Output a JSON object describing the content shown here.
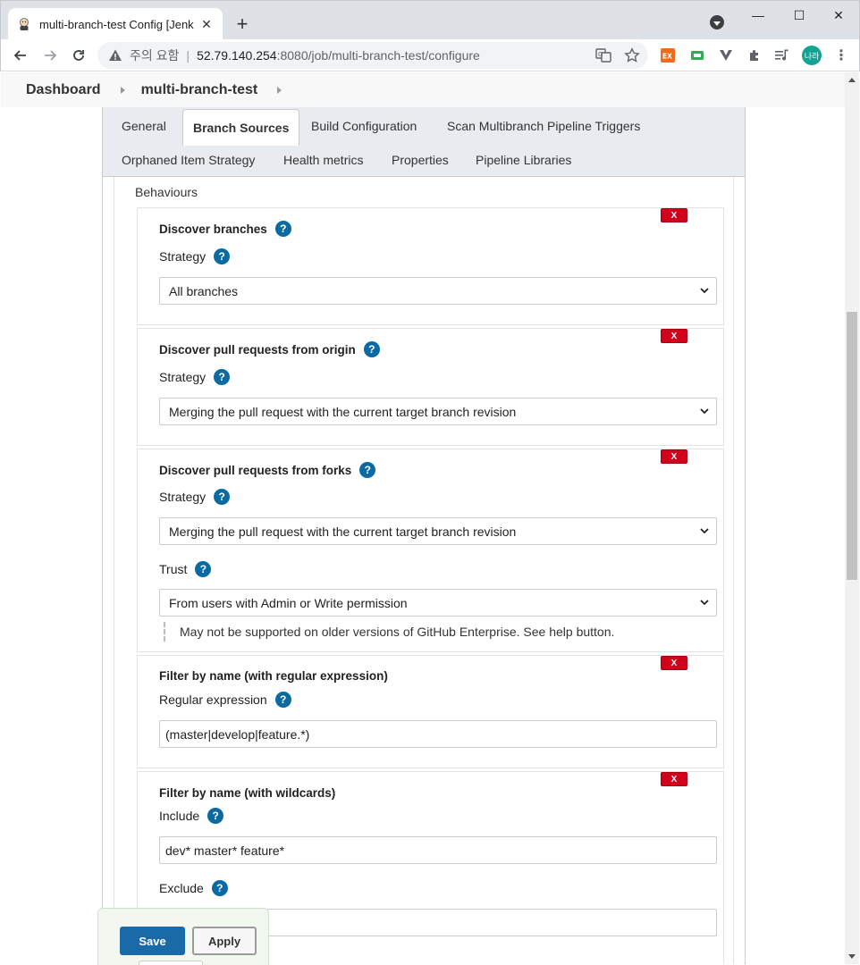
{
  "browser": {
    "tab_title": "multi-branch-test Config [Jenkins]",
    "tab_close": "✕",
    "new_tab": "+",
    "insecure_label": "주의 요함",
    "separator": "|",
    "url_host": "52.79.140.254",
    "url_rest": ":8080/job/multi-branch-test/configure",
    "profile_initials": "나라",
    "window_controls": {
      "minimize": "—",
      "maximize": "☐",
      "close": "✕"
    }
  },
  "breadcrumb": {
    "items": [
      "Dashboard",
      "multi-branch-test"
    ]
  },
  "config_tabs": {
    "row1": [
      "General",
      "Branch Sources",
      "Build Configuration",
      "Scan Multibranch Pipeline Triggers"
    ],
    "row2": [
      "Orphaned Item Strategy",
      "Health metrics",
      "Properties",
      "Pipeline Libraries"
    ],
    "active": "Branch Sources"
  },
  "behaviours": {
    "title": "Behaviours",
    "delete_label": "X",
    "help_label": "?",
    "discover_branches": {
      "title": "Discover branches",
      "strategy_label": "Strategy",
      "strategy_value": "All branches"
    },
    "discover_prs_origin": {
      "title": "Discover pull requests from origin",
      "strategy_label": "Strategy",
      "strategy_value": "Merging the pull request with the current target branch revision"
    },
    "discover_prs_forks": {
      "title": "Discover pull requests from forks",
      "strategy_label": "Strategy",
      "strategy_value": "Merging the pull request with the current target branch revision",
      "trust_label": "Trust",
      "trust_value": "From users with Admin or Write permission",
      "trust_note": "May not be supported on older versions of GitHub Enterprise. See help button."
    },
    "filter_regex": {
      "title": "Filter by name (with regular expression)",
      "regex_label": "Regular expression",
      "regex_value": "(master|develop|feature.*)"
    },
    "filter_wildcards": {
      "title": "Filter by name (with wildcards)",
      "include_label": "Include",
      "include_value": "dev* master* feature*",
      "exclude_label": "Exclude",
      "exclude_value": ""
    }
  },
  "actions": {
    "save_label": "Save",
    "apply_label": "Apply"
  }
}
